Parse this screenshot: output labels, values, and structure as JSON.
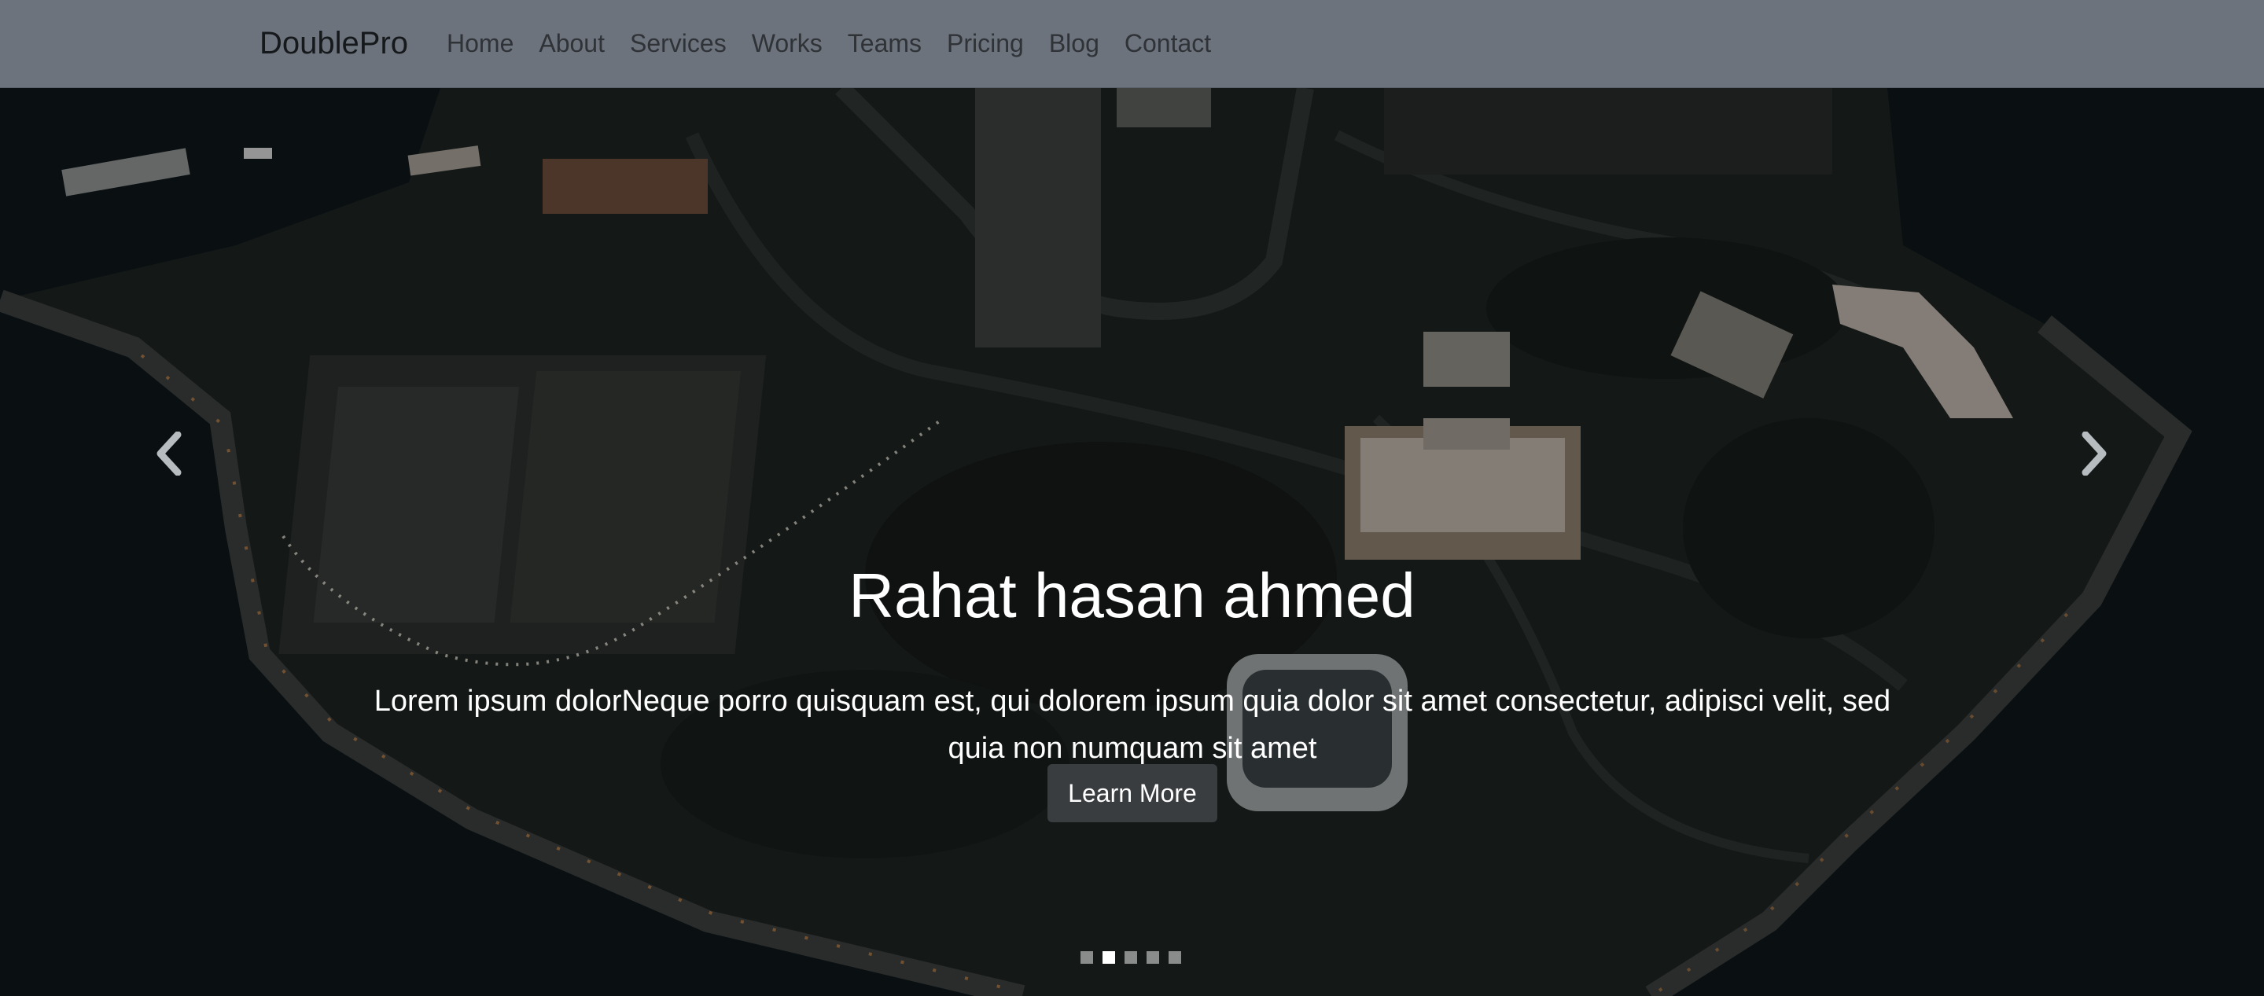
{
  "navbar": {
    "brand": "DoublePro",
    "links": [
      "Home",
      "About",
      "Services",
      "Works",
      "Teams",
      "Pricing",
      "Blog",
      "Contact"
    ]
  },
  "hero": {
    "title": "Rahat hasan ahmed",
    "text": "Lorem ipsum dolorNeque porro quisquam est, qui dolorem ipsum quia dolor sit amet consectetur, adipisci velit, sed quia non numquam sit amet",
    "button_label": "Learn More",
    "prev_icon": "chevron-left-icon",
    "next_icon": "chevron-right-icon",
    "indicators": {
      "count": 5,
      "active_index": 1
    }
  },
  "colors": {
    "navbar_bg": "#6c737c",
    "brand": "#16191c",
    "nav_link": "#2f3338",
    "button_bg": "#3a3d40",
    "caption_text": "#ffffff"
  }
}
